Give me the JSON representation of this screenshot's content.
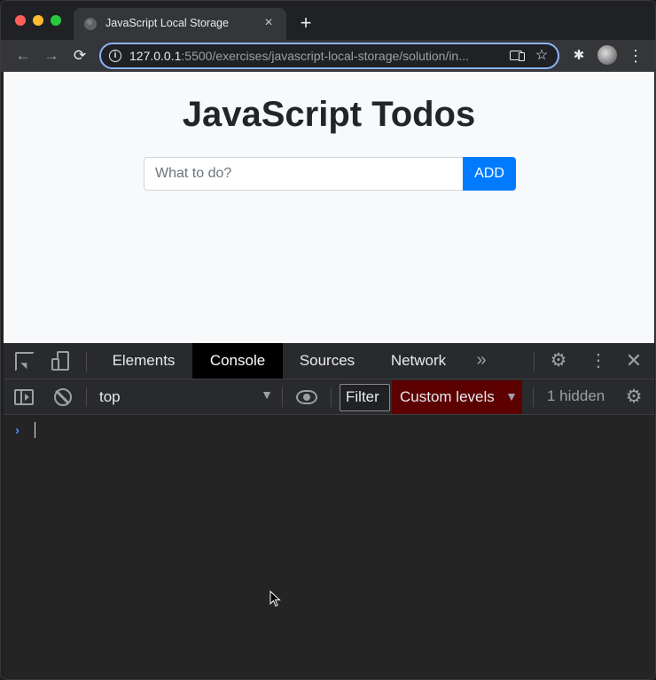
{
  "browser": {
    "tab_title": "JavaScript Local Storage",
    "tab_close": "×",
    "new_tab": "+",
    "url_host": "127.0.0.1",
    "url_rest": ":5500/exercises/javascript-local-storage/solution/in...",
    "nav": {
      "back": "←",
      "forward": "→",
      "reload": "⟳"
    },
    "icons": {
      "info": "i",
      "star": "☆",
      "extensions": "✱",
      "menu": "⋮"
    }
  },
  "page": {
    "title": "JavaScript Todos",
    "input_placeholder": "What to do?",
    "add_label": "ADD",
    "accent": "#007bff"
  },
  "devtools": {
    "tabs": [
      "Elements",
      "Console",
      "Sources",
      "Network"
    ],
    "active_tab": "Console",
    "more_tabs": "»",
    "gear": "⚙",
    "kebab": "⋮",
    "close": "✕",
    "console": {
      "context": "top",
      "context_arrow": "▼",
      "filter_label": "Filter",
      "levels_label": "Custom levels",
      "levels_arrow": "▼",
      "hidden_count": "1 hidden",
      "prompt": "›"
    }
  }
}
